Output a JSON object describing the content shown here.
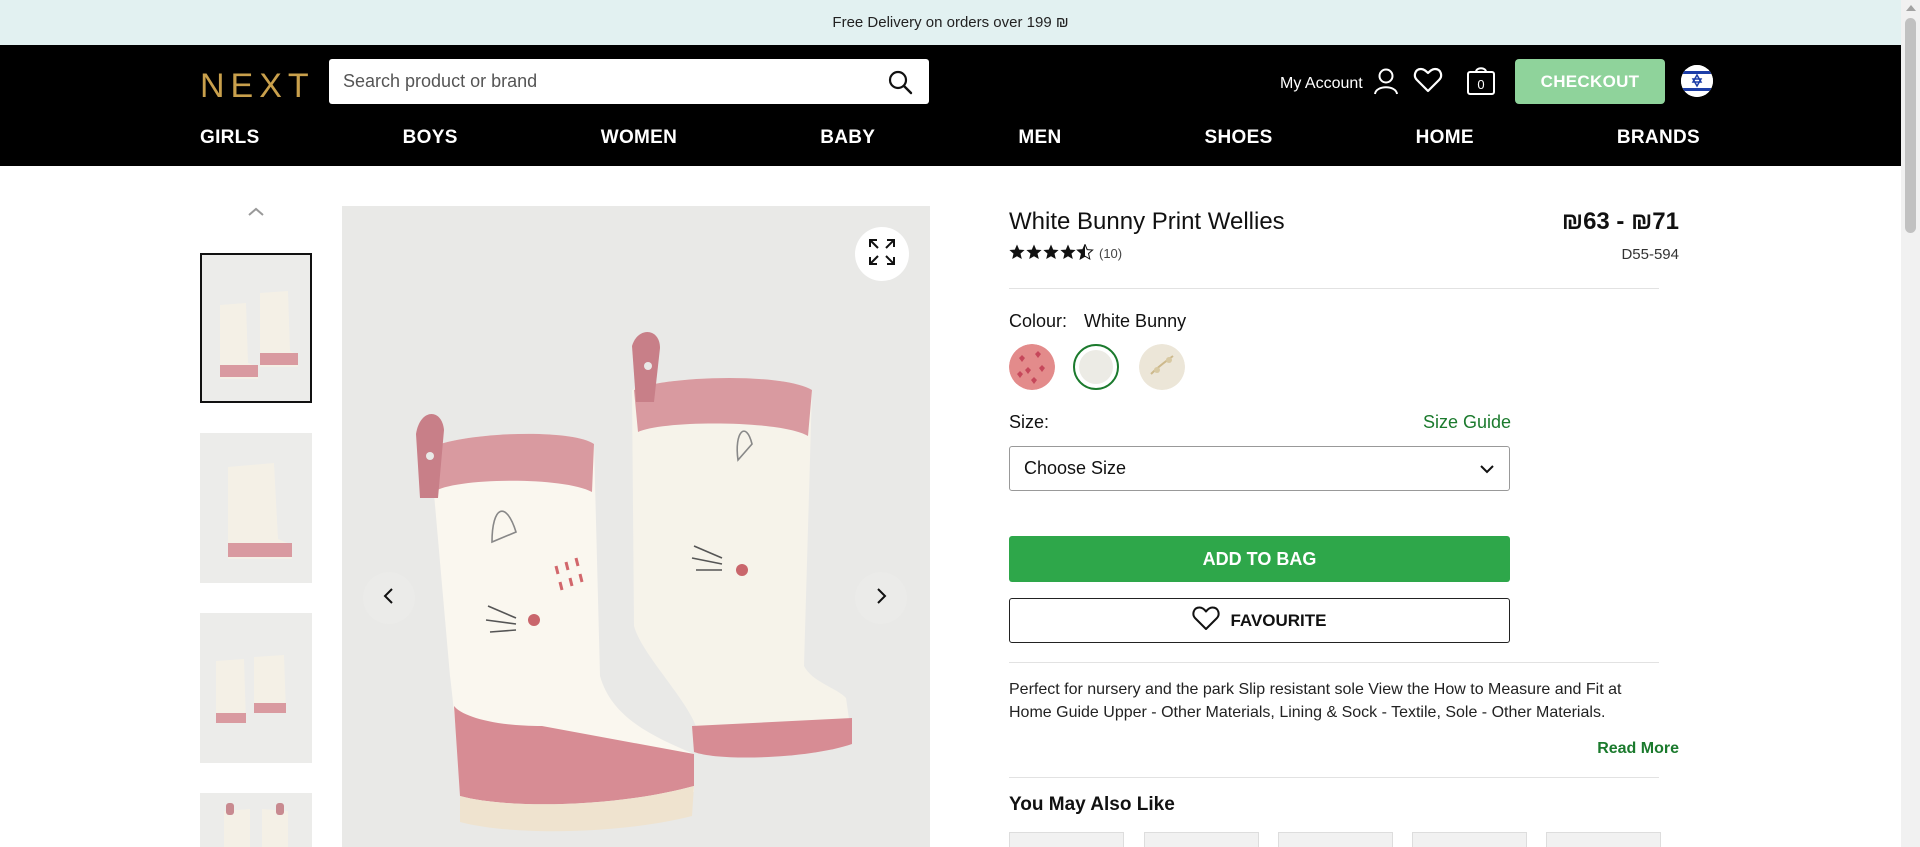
{
  "promo": {
    "text": "Free Delivery on orders over 199 ₪"
  },
  "header": {
    "logo": "NEXT",
    "search_placeholder": "Search product or brand",
    "account_label": "My Account",
    "bag_count": "0",
    "checkout_label": "CHECKOUT"
  },
  "nav": [
    "GIRLS",
    "BOYS",
    "WOMEN",
    "BABY",
    "MEN",
    "SHOES",
    "HOME",
    "BRANDS"
  ],
  "product": {
    "title": "White Bunny Print Wellies",
    "price": "₪63 - ₪71",
    "rating_value": 4.5,
    "review_count": "(10)",
    "sku": "D55-594",
    "colour_label": "Colour:",
    "colour_value": "White Bunny",
    "swatches": [
      {
        "name": "pink-heart",
        "color": "#e38b8b",
        "selected": false
      },
      {
        "name": "white-bunny",
        "color": "#ecebe5",
        "selected": true
      },
      {
        "name": "cream-floral",
        "color": "#ece6d8",
        "selected": false
      }
    ],
    "size_label": "Size:",
    "size_guide": "Size Guide",
    "size_select": "Choose Size",
    "add_to_bag": "ADD TO BAG",
    "favourite": "FAVOURITE",
    "description": "Perfect for nursery and the park Slip resistant sole View the How to Measure and Fit at Home Guide Upper - Other Materials, Lining & Sock - Textile, Sole - Other Materials.",
    "read_more": "Read More",
    "you_may_also_like": "You May Also Like"
  },
  "colors": {
    "accent_green": "#2ea74a",
    "link_green": "#1b7a2d",
    "logo_gold": "#c9a04c",
    "checkout_bg": "#8fd39b",
    "promo_bg": "#e2f1f1"
  }
}
